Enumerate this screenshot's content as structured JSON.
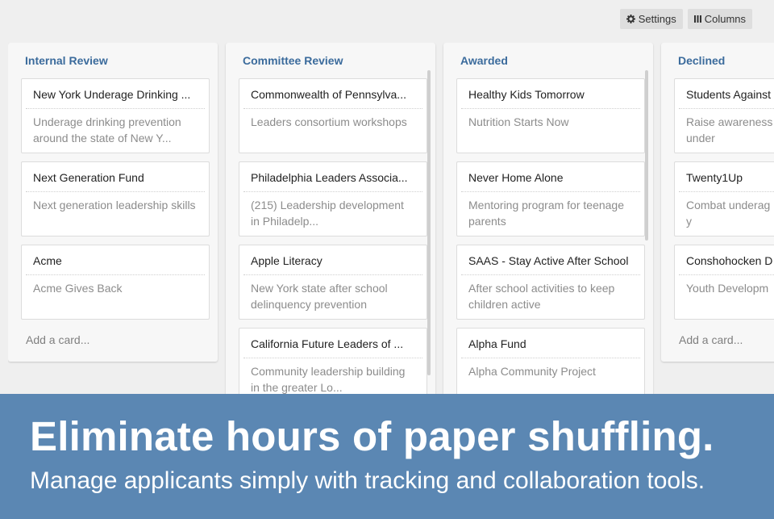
{
  "toolbar": {
    "settings_label": "Settings",
    "columns_label": "Columns"
  },
  "columns": [
    {
      "title": "Internal Review",
      "cards": [
        {
          "title": "New York Underage Drinking ...",
          "desc": "Underage drinking prevention around the state of New Y..."
        },
        {
          "title": "Next Generation Fund",
          "desc": "Next generation leadership skills"
        },
        {
          "title": "Acme",
          "desc": "Acme Gives Back"
        }
      ],
      "add_card": "Add a card..."
    },
    {
      "title": "Committee Review",
      "cards": [
        {
          "title": "Commonwealth of Pennsylva...",
          "desc": "Leaders consortium workshops"
        },
        {
          "title": "Philadelphia Leaders Associa...",
          "desc": "(215) Leadership development in Philadelp..."
        },
        {
          "title": "Apple Literacy",
          "desc": "New York state after school delinquency prevention"
        },
        {
          "title": "California Future Leaders of ...",
          "desc": "Community leadership building in the greater Lo..."
        }
      ]
    },
    {
      "title": "Awarded",
      "cards": [
        {
          "title": "Healthy Kids Tomorrow",
          "desc": "Nutrition Starts Now"
        },
        {
          "title": "Never Home Alone",
          "desc": "Mentoring program for teenage parents"
        },
        {
          "title": "SAAS - Stay Active After School",
          "desc": "After school activities to keep children active"
        },
        {
          "title": "Alpha Fund",
          "desc": "Alpha Community Project"
        }
      ]
    },
    {
      "title": "Declined",
      "cards": [
        {
          "title": "Students Against",
          "desc": "Raise awareness dangers of under"
        },
        {
          "title": "Twenty1Up",
          "desc": "Combat underag underprivileged y"
        },
        {
          "title": "Conshohocken D",
          "desc": "Youth Developm"
        }
      ],
      "add_card": "Add a card..."
    }
  ],
  "banner": {
    "headline": "Eliminate hours of paper shuffling.",
    "subline": "Manage applicants simply with tracking and collaboration tools."
  },
  "colors": {
    "accent": "#3b6b9c",
    "banner": "#5b87b3",
    "background": "#efefef"
  },
  "icons": {
    "settings": "gear-icon",
    "columns": "columns-icon"
  }
}
